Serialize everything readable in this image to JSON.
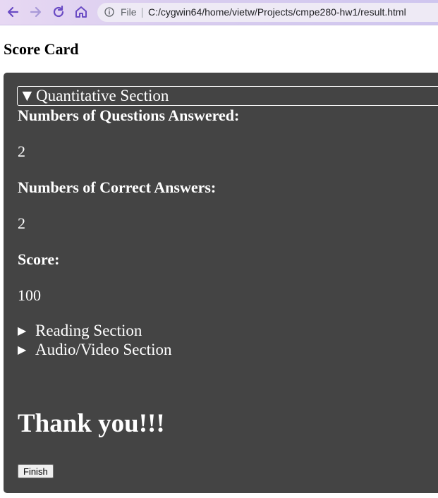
{
  "browser": {
    "file_label": "File",
    "url": "C:/cygwin64/home/vietw/Projects/cmpe280-hw1/result.html"
  },
  "page": {
    "title": "Score Card"
  },
  "sections": {
    "quantitative": {
      "title": "Quantitative Section",
      "questions_answered_label": "Numbers of Questions Answered:",
      "questions_answered": "2",
      "correct_answers_label": "Numbers of Correct Answers:",
      "correct_answers": "2",
      "score_label": "Score:",
      "score": "100"
    },
    "reading": {
      "title": "Reading Section"
    },
    "audio_video": {
      "title": "Audio/Video Section"
    }
  },
  "footer": {
    "thanks": "Thank you!!!",
    "finish_label": "Finish"
  },
  "colors": {
    "card_background": "#444444",
    "text": "#ffffff"
  }
}
